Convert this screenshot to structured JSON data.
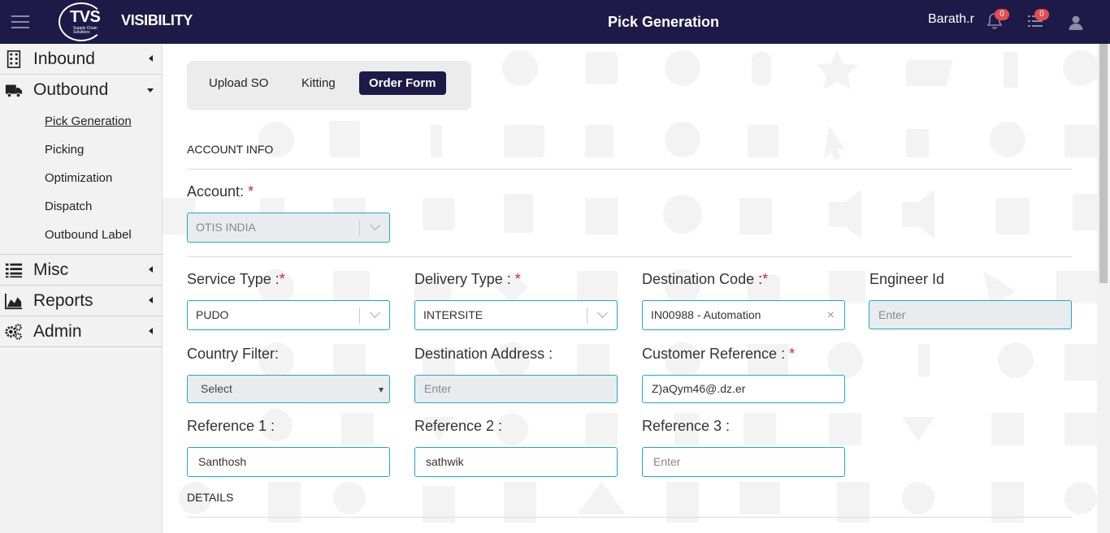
{
  "header": {
    "logo_text": "TVS",
    "logo_subtext": "Supply Chain Solutions",
    "app_name": "VISIBILITY",
    "page_title": "Pick Generation",
    "username": "Barath.r",
    "notifications_count": "0",
    "tasks_count": "0"
  },
  "sidebar": {
    "inbound": "Inbound",
    "outbound": "Outbound",
    "outbound_items": [
      "Pick Generation",
      "Picking",
      "Optimization",
      "Dispatch",
      "Outbound Label"
    ],
    "misc": "Misc",
    "reports": "Reports",
    "admin": "Admin"
  },
  "tabs": {
    "upload_so": "Upload SO",
    "kitting": "Kitting",
    "order_form": "Order Form"
  },
  "sections": {
    "account_info": "ACCOUNT INFO",
    "details": "DETAILS"
  },
  "form": {
    "account": {
      "label": "Account:",
      "required": "*",
      "value": "OTIS INDIA"
    },
    "service_type": {
      "label": "Service Type :",
      "required": "*",
      "value": "PUDO"
    },
    "delivery_type": {
      "label": "Delivery Type : ",
      "required": "*",
      "value": "INTERSITE"
    },
    "destination_code": {
      "label": "Destination Code :",
      "required": "*",
      "value": "IN00988 - Automation",
      "clear": "×"
    },
    "engineer_id": {
      "label": "Engineer Id",
      "placeholder": "Enter"
    },
    "country_filter": {
      "label": "Country Filter:",
      "value": "Select"
    },
    "destination_address": {
      "label": "Destination Address :",
      "placeholder": "Enter"
    },
    "customer_reference": {
      "label": "Customer Reference : ",
      "required": "*",
      "value": "Z)aQym46@.dz.er"
    },
    "reference_1": {
      "label": "Reference 1 :",
      "value": "Santhosh"
    },
    "reference_2": {
      "label": "Reference 2 :",
      "value": "sathwik"
    },
    "reference_3": {
      "label": "Reference 3 :",
      "placeholder": "Enter"
    }
  },
  "colors": {
    "header_bg": "#1d1a47",
    "accent_border": "#1ea8c8",
    "required": "#e02020",
    "badge": "#e74c4c"
  }
}
